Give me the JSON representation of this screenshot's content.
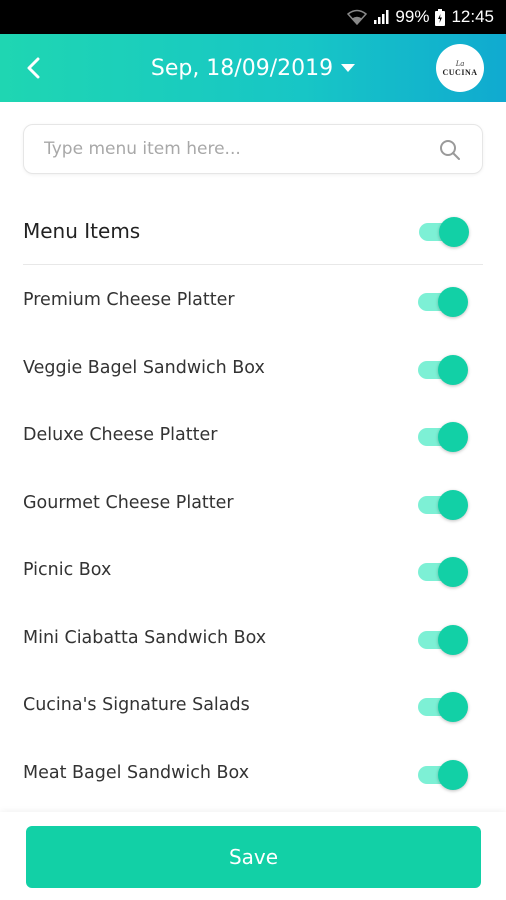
{
  "status_bar": {
    "battery": "99%",
    "time": "12:45"
  },
  "header": {
    "date_title": "Sep, 18/09/2019",
    "logo_script": "La",
    "logo_text": "CUCINA"
  },
  "search": {
    "placeholder": "Type menu item here...",
    "value": ""
  },
  "section": {
    "title": "Menu Items",
    "toggle_on": true
  },
  "menu_items": [
    {
      "label": "Premium Cheese Platter",
      "enabled": true
    },
    {
      "label": "Veggie Bagel Sandwich Box",
      "enabled": true
    },
    {
      "label": "Deluxe Cheese Platter",
      "enabled": true
    },
    {
      "label": "Gourmet Cheese Platter",
      "enabled": true
    },
    {
      "label": "Picnic Box",
      "enabled": true
    },
    {
      "label": "Mini Ciabatta Sandwich Box",
      "enabled": true
    },
    {
      "label": "Cucina's Signature Salads",
      "enabled": true
    },
    {
      "label": "Meat Bagel Sandwich Box",
      "enabled": true
    }
  ],
  "footer": {
    "save_label": "Save"
  },
  "colors": {
    "accent": "#12d0a6",
    "header_gradient_start": "#1fd6b2",
    "header_gradient_end": "#10aad0"
  }
}
